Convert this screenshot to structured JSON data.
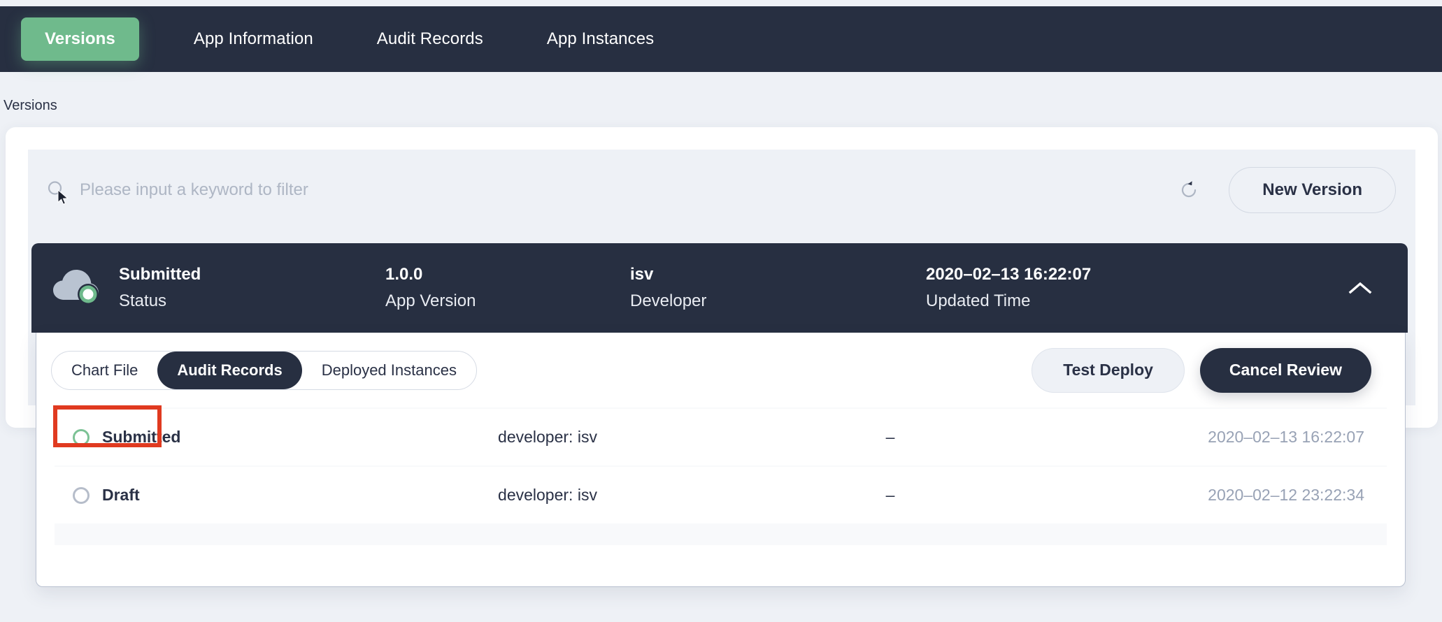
{
  "topnav": {
    "tabs": [
      {
        "label": "Versions",
        "active": true
      },
      {
        "label": "App Information",
        "active": false
      },
      {
        "label": "Audit Records",
        "active": false
      },
      {
        "label": "App Instances",
        "active": false
      }
    ],
    "active_color": "#6fba8c",
    "background": "#272f41"
  },
  "page": {
    "title": "Versions"
  },
  "search": {
    "placeholder": "Please input a keyword to filter",
    "value": "",
    "refresh_icon": "refresh-icon",
    "search_icon": "search-icon",
    "new_version_label": "New Version"
  },
  "version_header": {
    "icon": "cloud-status-icon",
    "status_value": "Submitted",
    "status_label": "Status",
    "version_value": "1.0.0",
    "version_label": "App Version",
    "developer_value": "isv",
    "developer_label": "Developer",
    "updated_value": "2020–02–13 16:22:07",
    "updated_label": "Updated Time",
    "collapse_icon": "chevron-up-icon"
  },
  "expanded": {
    "segments": [
      {
        "label": "Chart File",
        "active": false
      },
      {
        "label": "Audit Records",
        "active": true
      },
      {
        "label": "Deployed Instances",
        "active": false
      }
    ],
    "test_deploy_label": "Test Deploy",
    "cancel_review_label": "Cancel Review",
    "records": [
      {
        "status": "Submitted",
        "status_color": "#7cc295",
        "developer": "developer: isv",
        "note": "–",
        "time": "2020–02–13 16:22:07"
      },
      {
        "status": "Draft",
        "status_color": "#b6bdca",
        "developer": "developer: isv",
        "note": "–",
        "time": "2020–02–12 23:22:34"
      }
    ]
  },
  "annotation": {
    "highlight_color": "#e03a20"
  }
}
